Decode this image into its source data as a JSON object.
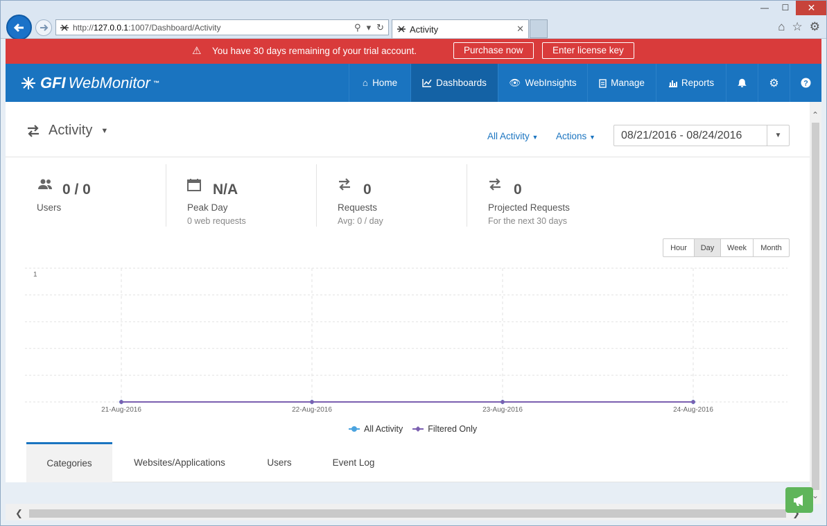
{
  "browser": {
    "url_prefix": "http://",
    "url_host": "127.0.0.1",
    "url_path": ":1007/Dashboard/Activity",
    "tab_title": "Activity",
    "minimize": "—",
    "maximize": "☐",
    "close": "✕"
  },
  "trial": {
    "message": "You have 30 days remaining of your trial account.",
    "purchase": "Purchase now",
    "license": "Enter license key"
  },
  "app": {
    "logo_gfi": "GFI",
    "logo_web": "WebMonitor",
    "logo_tm": "™",
    "nav": {
      "home": "Home",
      "dashboards": "Dashboards",
      "webinsights": "WebInsights",
      "manage": "Manage",
      "reports": "Reports"
    }
  },
  "page": {
    "title": "Activity",
    "all_activity": "All Activity",
    "actions": "Actions",
    "date_range": "08/21/2016 - 08/24/2016"
  },
  "stats": {
    "users": {
      "value": "0 / 0",
      "label": "Users"
    },
    "peak": {
      "value": "N/A",
      "label": "Peak Day",
      "sub": "0 web requests"
    },
    "requests": {
      "value": "0",
      "label": "Requests",
      "sub": "Avg: 0 / day"
    },
    "projected": {
      "value": "0",
      "label": "Projected Requests",
      "sub": "For the next 30 days"
    }
  },
  "range_buttons": {
    "hour": "Hour",
    "day": "Day",
    "week": "Week",
    "month": "Month"
  },
  "chart_data": {
    "type": "line",
    "categories": [
      "21-Aug-2016",
      "22-Aug-2016",
      "23-Aug-2016",
      "24-Aug-2016"
    ],
    "series": [
      {
        "name": "All Activity",
        "values": [
          0,
          0,
          0,
          0
        ],
        "color": "#4aa3df"
      },
      {
        "name": "Filtered Only",
        "values": [
          0,
          0,
          0,
          0
        ],
        "color": "#7b5fb0"
      }
    ],
    "ylim": [
      0,
      1
    ],
    "ytick": "1",
    "grid": true,
    "legend": "bottom"
  },
  "tabs": {
    "categories": "Categories",
    "websites": "Websites/Applications",
    "users": "Users",
    "eventlog": "Event Log"
  },
  "colors": {
    "accent": "#1a74c0",
    "banner": "#d93b3b",
    "feedback": "#5fb55a"
  }
}
